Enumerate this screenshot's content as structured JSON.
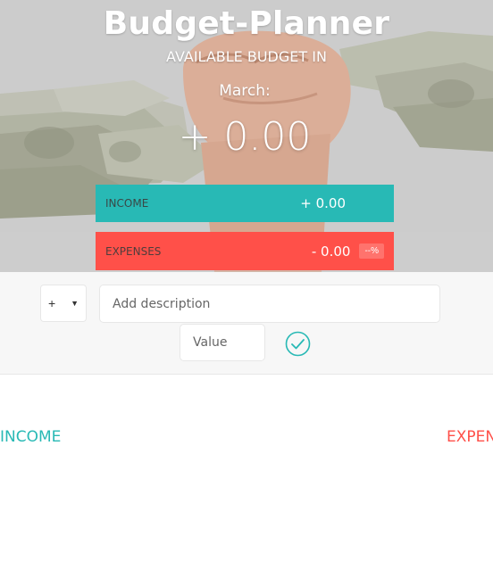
{
  "app": {
    "title": "Budget-Planner"
  },
  "header": {
    "subtitle": "AVAILABLE BUDGET IN",
    "month": "March:",
    "available_budget": "+ 0.00"
  },
  "summary": {
    "income_label": "INCOME",
    "income_value": "+ 0.00",
    "expenses_label": "EXPENSES",
    "expenses_value": "- 0.00",
    "expenses_percentage": "--%"
  },
  "add_form": {
    "type_selected": "+",
    "description_placeholder": "Add description",
    "value_placeholder": "Value"
  },
  "lists": {
    "income_title": "INCOME",
    "expenses_title": "EXPENSES"
  },
  "colors": {
    "income": "#28b9b5",
    "expenses": "#ff5049"
  },
  "icons": {
    "confirm": "check-circle-icon",
    "dropdown": "caret-down-icon"
  }
}
